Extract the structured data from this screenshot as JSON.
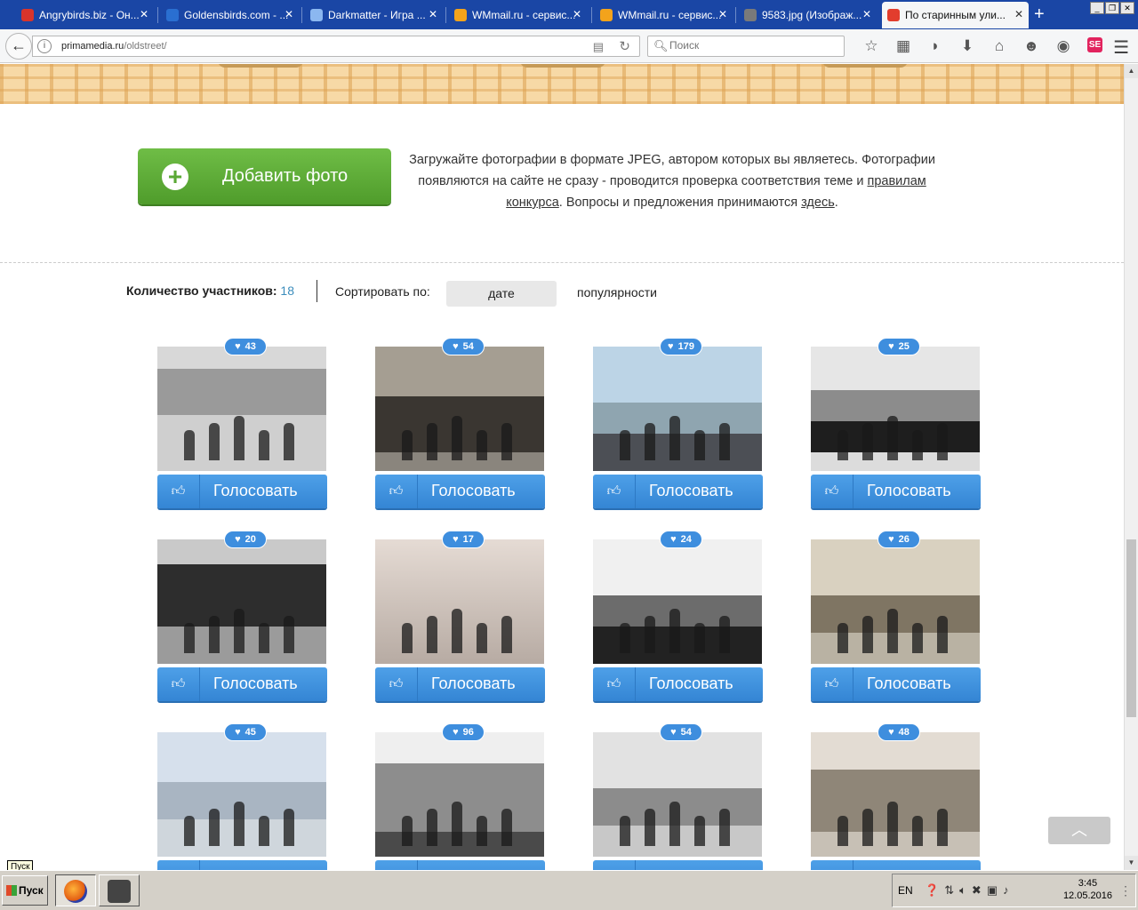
{
  "browser": {
    "tabs": [
      {
        "label": "Angrybirds.biz - Он...",
        "icon_color": "#d9342b"
      },
      {
        "label": "Goldensbirds.com - ...",
        "icon_color": "#2a6fd1"
      },
      {
        "label": "Darkmatter - Игра ...",
        "icon_color": "#8bb7f0"
      },
      {
        "label": "WMmail.ru - сервис...",
        "icon_color": "#f3a31b"
      },
      {
        "label": "WMmail.ru - сервис...",
        "icon_color": "#f3a31b"
      },
      {
        "label": "9583.jpg (Изображ...",
        "icon_color": "#7a7a7a"
      },
      {
        "label": "По старинным ули...",
        "icon_color": "#e23d2d"
      }
    ],
    "url_domain": "primamedia.ru",
    "url_path": "/oldstreet/",
    "search_placeholder": "Поиск",
    "toolbar_icons": [
      "star-icon",
      "reading-list-icon",
      "pocket-icon",
      "download-icon",
      "home-icon",
      "chat-icon",
      "eye-icon",
      "se-icon"
    ],
    "se_label": "SE"
  },
  "page": {
    "add_button": "Добавить фото",
    "info_text_1": "Загружайте фотографии в формате JPEG, автором которых вы являетесь. Фотографии появляются на сайте не сразу - проводится проверка соответствия теме и ",
    "info_link_rules": "правилам конкурса",
    "info_text_2": ". Вопросы и предложения принимаются ",
    "info_link_here": "здесь",
    "info_text_3": ".",
    "participants_label": "Количество участников:",
    "participants_count": "18",
    "sort_label": "Сортировать по:",
    "sort_date": "дате",
    "sort_popularity": "популярности",
    "vote_label": "Голосовать",
    "photos": [
      {
        "likes": "43",
        "style": "bw1"
      },
      {
        "likes": "54",
        "style": "bw2"
      },
      {
        "likes": "179",
        "style": "col1"
      },
      {
        "likes": "25",
        "style": "bw3"
      },
      {
        "likes": "20",
        "style": "bw4"
      },
      {
        "likes": "17",
        "style": "sep1"
      },
      {
        "likes": "24",
        "style": "bw5"
      },
      {
        "likes": "26",
        "style": "sep2"
      },
      {
        "likes": "45",
        "style": "col2"
      },
      {
        "likes": "96",
        "style": "bw6"
      },
      {
        "likes": "54",
        "style": "bw7"
      },
      {
        "likes": "48",
        "style": "sep3"
      }
    ],
    "scroll_top_icon": "chevron-up-icon"
  },
  "taskbar": {
    "start_tip": "Пуск",
    "start_label": "Пуск",
    "lang": "EN",
    "time": "3:45",
    "date": "12.05.2016"
  }
}
